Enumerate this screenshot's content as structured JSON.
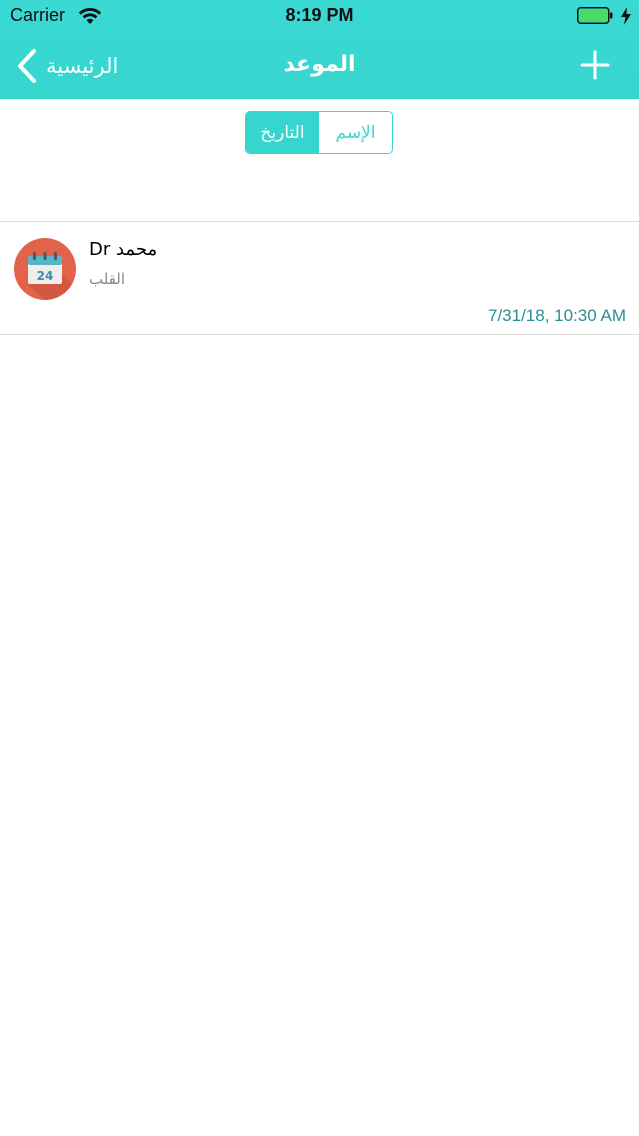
{
  "status_bar": {
    "carrier": "Carrier",
    "time": "8:19 PM"
  },
  "nav": {
    "back_label": "الرئيسية",
    "title": "الموعد",
    "add_icon": "plus-icon"
  },
  "segmented": {
    "options": [
      "التاريخ",
      "الإسم"
    ],
    "selected": "التاريخ"
  },
  "appointments": [
    {
      "title": "Dr محمد",
      "subtitle": "القلب",
      "datetime": "7/31/18, 10:30 AM",
      "calendar_day": "24",
      "icon": "calendar-icon"
    }
  ],
  "colors": {
    "accent": "#36d6cf",
    "date_text": "#2a8d96",
    "avatar_bg": "#e2624a"
  }
}
